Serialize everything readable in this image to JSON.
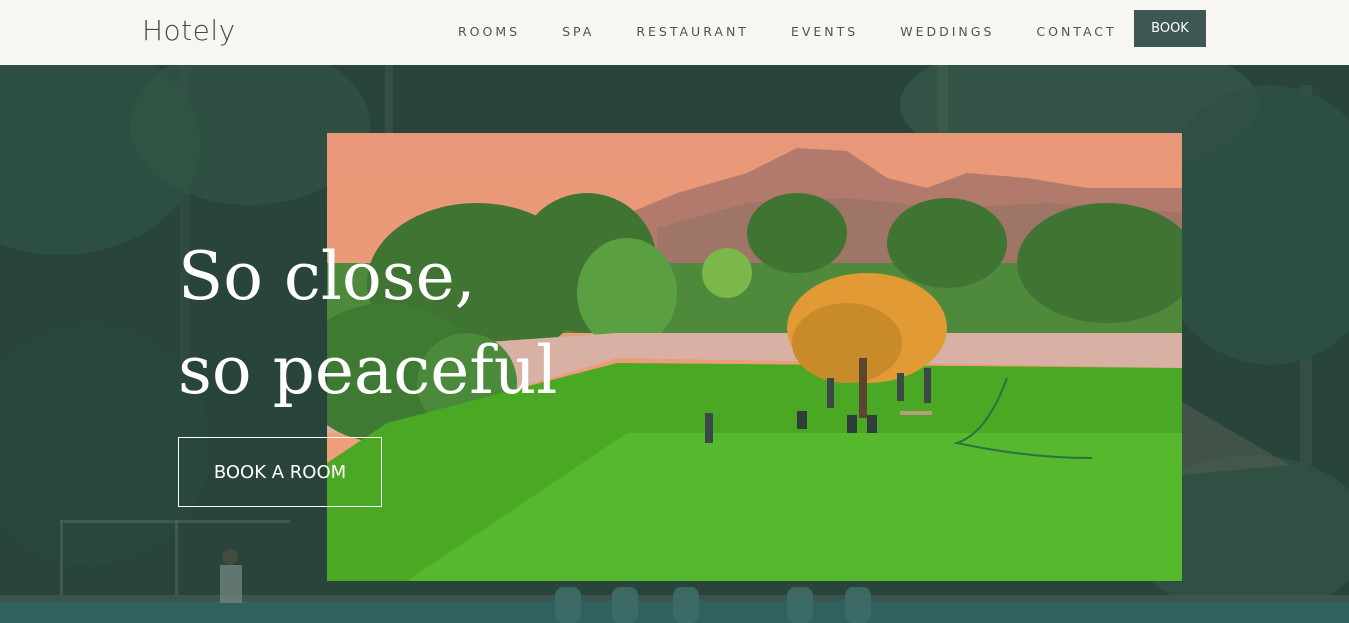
{
  "brand": {
    "logo": "Hotely"
  },
  "nav": {
    "links": [
      "ROOMS",
      "SPA",
      "RESTAURANT",
      "EVENTS",
      "WEDDINGS",
      "CONTACT"
    ],
    "book_label": "BOOK"
  },
  "hero": {
    "headline_line1": "So close,",
    "headline_line2": "so peaceful",
    "cta_label": "BOOK A ROOM"
  },
  "colors": {
    "accent": "#3e5752",
    "nav_bg": "#f8f6f2",
    "hero_tint": "#26403a"
  }
}
